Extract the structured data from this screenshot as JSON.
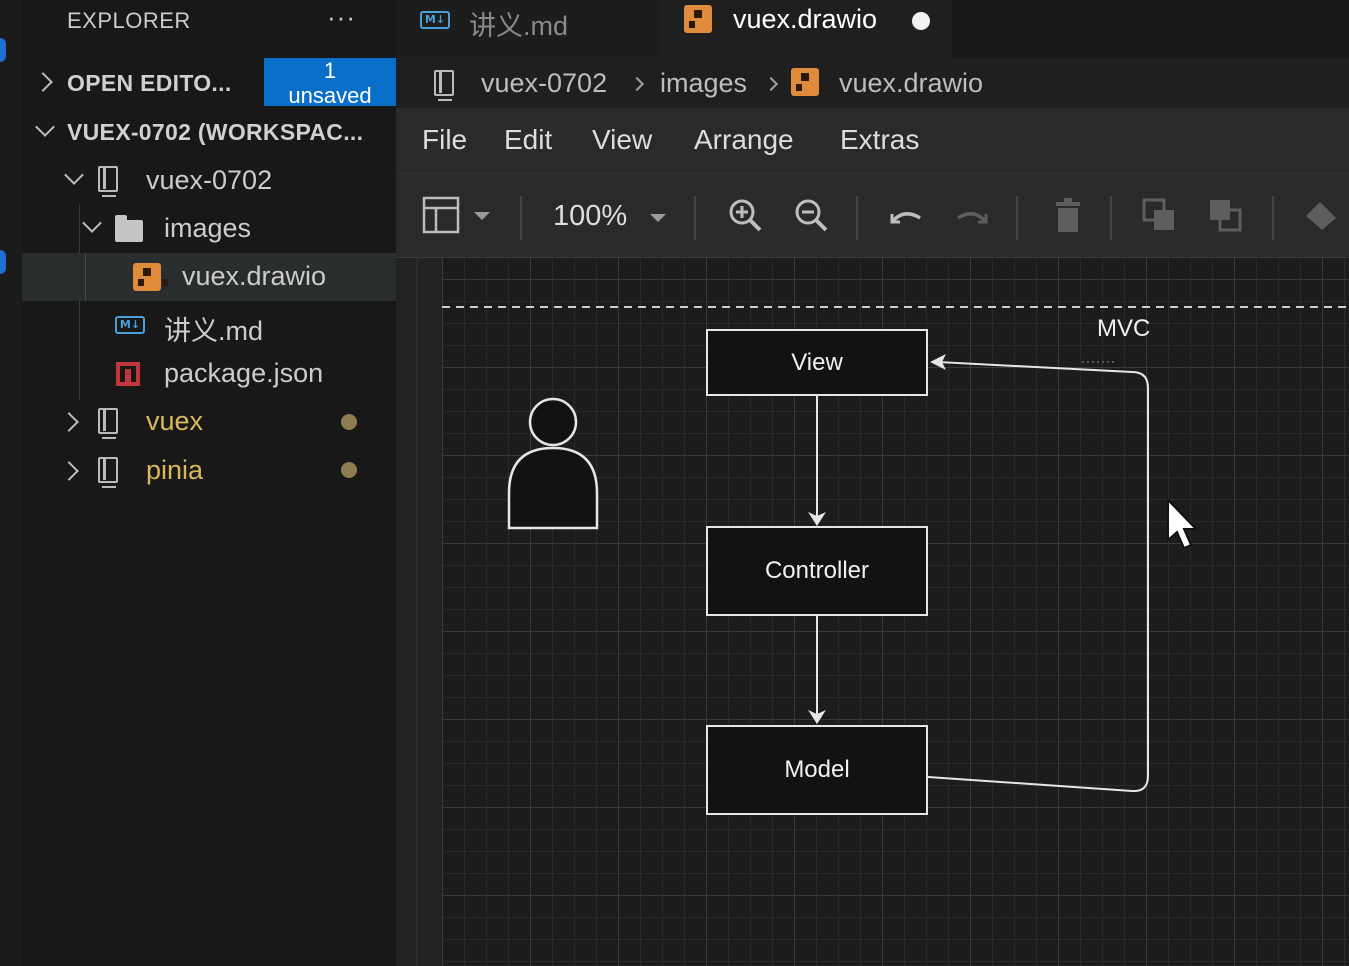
{
  "explorer": {
    "title": "EXPLORER",
    "more": "···",
    "open_editors_label": "OPEN EDITO...",
    "unsaved_count": "1",
    "unsaved_label": "unsaved",
    "workspace_label": "VUEX-0702 (WORKSPAC...",
    "tree": {
      "vuex0702": "vuex-0702",
      "images": "images",
      "drawio": "vuex.drawio",
      "md": "讲义.md",
      "pkg": "package.json",
      "vuex": "vuex",
      "pinia": "pinia"
    },
    "colors": {
      "modified": "#d9b85a",
      "badge": "#0a6fc9"
    }
  },
  "tabs": [
    {
      "label": "讲义.md",
      "icon": "markdown-icon"
    },
    {
      "label": "vuex.drawio",
      "icon": "drawio-icon",
      "dirty": true
    }
  ],
  "md_icon_text": "M↓",
  "breadcrumb": [
    "vuex-0702",
    "images",
    "vuex.drawio"
  ],
  "menu": [
    "File",
    "Edit",
    "View",
    "Arrange",
    "Extras"
  ],
  "toolbar": {
    "zoom": "100%"
  },
  "diagram": {
    "container_label": "MVC",
    "nodes": {
      "view": "View",
      "controller": "Controller",
      "model": "Model"
    }
  }
}
